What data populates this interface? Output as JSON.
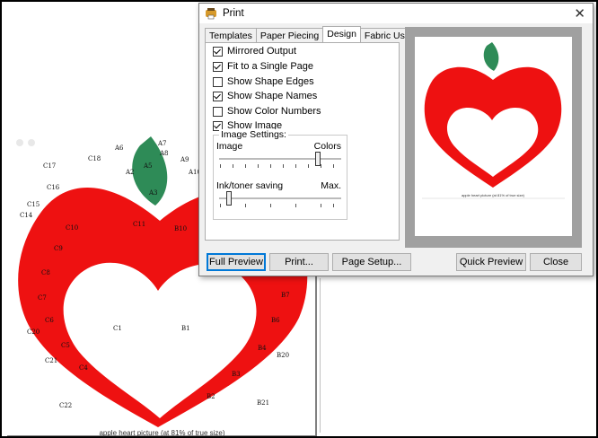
{
  "dialog": {
    "title": "Print",
    "tabs": [
      {
        "label": "Templates"
      },
      {
        "label": "Paper Piecing"
      },
      {
        "label": "Design"
      },
      {
        "label": "Fabric Usage"
      }
    ],
    "options": [
      {
        "label": "Mirrored Output",
        "checked": true
      },
      {
        "label": "Fit to a Single Page",
        "checked": true
      },
      {
        "label": "Show Shape Edges",
        "checked": false
      },
      {
        "label": "Show Shape Names",
        "checked": true
      },
      {
        "label": "Show Color Numbers",
        "checked": false
      },
      {
        "label": "Show Image",
        "checked": true
      }
    ],
    "image_settings": {
      "legend": "Image Settings:",
      "image_label": "Image",
      "colors_label": "Colors",
      "ink_label": "Ink/toner saving",
      "max_label": "Max."
    },
    "buttons": {
      "full_preview": "Full Preview",
      "print": "Print...",
      "page_setup": "Page Setup...",
      "quick_preview": "Quick Preview",
      "close": "Close"
    },
    "preview_caption": "apple heart picture (at 81% of true size)"
  },
  "pattern": {
    "caption": "apple heart picture (at 81% of true size)",
    "labels": [
      "A6",
      "A7",
      "A8",
      "A9",
      "A10",
      "A5",
      "A2",
      "A3",
      "C18",
      "C17",
      "C16",
      "C15",
      "C14",
      "C10",
      "C11",
      "B10",
      "C9",
      "C8",
      "C7",
      "B7",
      "C6",
      "B6",
      "C20",
      "C5",
      "C1",
      "B1",
      "B4",
      "B20",
      "C21",
      "C4",
      "B3",
      "B2",
      "C22",
      "B21"
    ],
    "colors": {
      "apple": "#ee1111",
      "leaf": "#2e8b57",
      "heart": "#ffffff"
    }
  }
}
